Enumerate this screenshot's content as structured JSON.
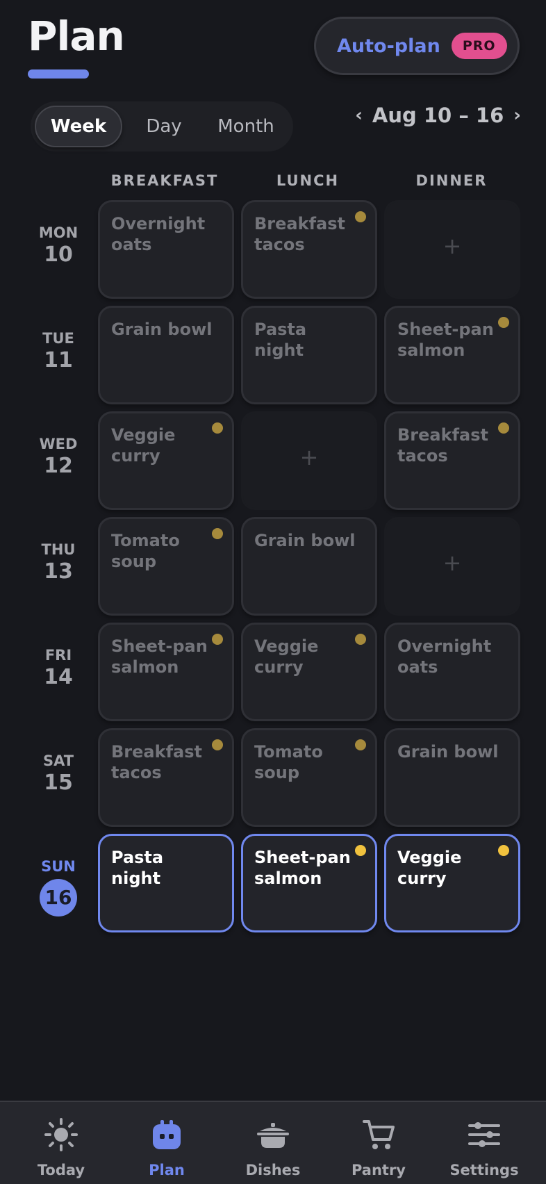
{
  "header": {
    "title": "Plan",
    "autoplan_label": "Auto-plan",
    "pro_badge": "PRO"
  },
  "view_switch": {
    "options": [
      "Week",
      "Day",
      "Month"
    ],
    "selected": "Week"
  },
  "date_range": {
    "prev": "‹",
    "label": "Aug 10 – 16",
    "next": "›"
  },
  "columns": [
    "BREAKFAST",
    "LUNCH",
    "DINNER"
  ],
  "days": [
    {
      "dow": "MON",
      "num": "10",
      "meals": [
        {
          "text": "Overnight oats",
          "dot": false
        },
        {
          "text": "Breakfast tacos",
          "dot": true
        },
        {
          "text": "+",
          "empty": true
        }
      ]
    },
    {
      "dow": "TUE",
      "num": "11",
      "meals": [
        {
          "text": "Grain bowl",
          "dot": false
        },
        {
          "text": "Pasta night",
          "dot": false
        },
        {
          "text": "Sheet-pan salmon",
          "dot": true
        }
      ]
    },
    {
      "dow": "WED",
      "num": "12",
      "meals": [
        {
          "text": "Veggie curry",
          "dot": true
        },
        {
          "text": "+",
          "empty": true
        },
        {
          "text": "Breakfast tacos",
          "dot": true
        }
      ]
    },
    {
      "dow": "THU",
      "num": "13",
      "meals": [
        {
          "text": "Tomato soup",
          "dot": true
        },
        {
          "text": "Grain bowl",
          "dot": false
        },
        {
          "text": "+",
          "empty": true
        }
      ]
    },
    {
      "dow": "FRI",
      "num": "14",
      "meals": [
        {
          "text": "Sheet-pan salmon",
          "dot": true
        },
        {
          "text": "Veggie curry",
          "dot": true
        },
        {
          "text": "Overnight oats",
          "dot": false
        }
      ]
    },
    {
      "dow": "SAT",
      "num": "15",
      "meals": [
        {
          "text": "Breakfast tacos",
          "dot": true
        },
        {
          "text": "Tomato soup",
          "dot": true
        },
        {
          "text": "Grain bowl",
          "dot": false
        }
      ]
    },
    {
      "dow": "SUN",
      "num": "16",
      "today": true,
      "meals": [
        {
          "text": "Pasta night",
          "dot": false
        },
        {
          "text": "Sheet-pan salmon",
          "dot": true
        },
        {
          "text": "Veggie curry",
          "dot": true
        }
      ]
    }
  ],
  "tabbar": {
    "items": [
      {
        "label": "Today",
        "icon": "sun-icon"
      },
      {
        "label": "Plan",
        "icon": "robot-icon",
        "active": true
      },
      {
        "label": "Dishes",
        "icon": "pot-icon"
      },
      {
        "label": "Pantry",
        "icon": "cart-icon"
      },
      {
        "label": "Settings",
        "icon": "sliders-icon"
      }
    ]
  },
  "colors": {
    "background": "#17181d",
    "accent": "#6f86ea",
    "pro_badge": "#e24f8f",
    "dot_muted": "#a68a3c",
    "dot_today": "#f1c23e"
  }
}
